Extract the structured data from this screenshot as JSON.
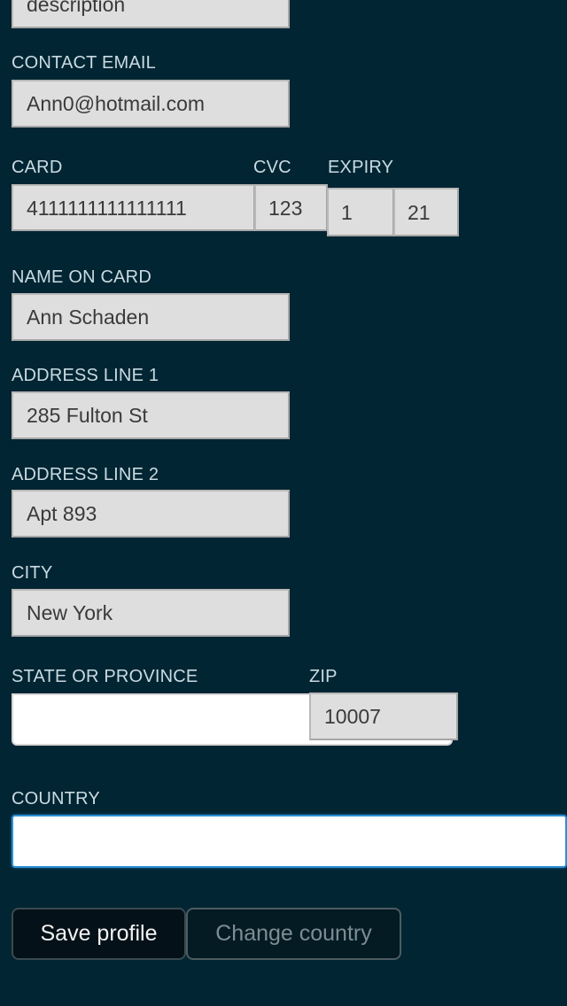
{
  "form": {
    "description": {
      "value": "description"
    },
    "contact_email": {
      "label": "CONTACT EMAIL",
      "value": "Ann0@hotmail.com"
    },
    "card": {
      "label": "CARD",
      "value": "4111111111111111"
    },
    "cvc": {
      "label": "CVC",
      "value": "123"
    },
    "expiry": {
      "label": "EXPIRY",
      "month": "1",
      "year": "21"
    },
    "name_on_card": {
      "label": "NAME ON CARD",
      "value": "Ann Schaden"
    },
    "address_line_1": {
      "label": "ADDRESS LINE 1",
      "value": "285 Fulton St"
    },
    "address_line_2": {
      "label": "ADDRESS LINE 2",
      "value": "Apt 893"
    },
    "city": {
      "label": "CITY",
      "value": "New York"
    },
    "state": {
      "label": "STATE OR PROVINCE",
      "value": ""
    },
    "zip": {
      "label": "ZIP",
      "value": "10007"
    },
    "country": {
      "label": "COUNTRY",
      "value": ""
    }
  },
  "actions": {
    "save_label": "Save profile",
    "change_country_label": "Change country"
  },
  "colors": {
    "background": "#022533",
    "label": "#c9dbe2",
    "field_background": "#dedede",
    "focus_border": "#2d8fd6"
  }
}
